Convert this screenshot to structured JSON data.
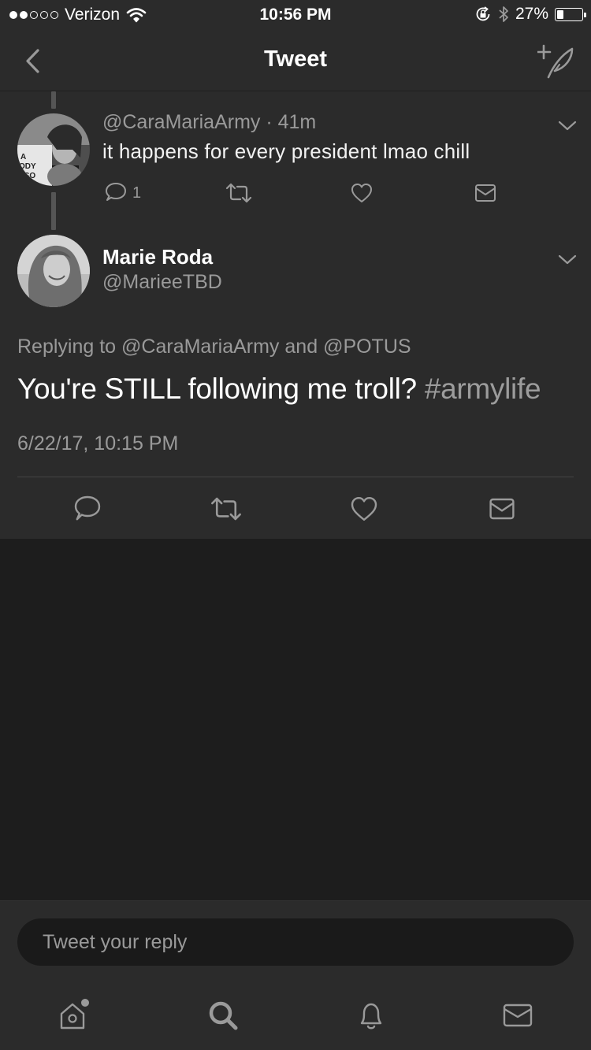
{
  "status_bar": {
    "carrier": "Verizon",
    "time": "10:56 PM",
    "battery": "27%",
    "battery_level": 0.27,
    "signal_bars_filled": 2,
    "signal_bars_total": 5,
    "icons": [
      "wifi-icon",
      "orientation-lock-icon",
      "bluetooth-icon",
      "battery-icon"
    ]
  },
  "nav": {
    "title": "Tweet",
    "back_icon": "chevron-left-icon",
    "compose_icon": "compose-tweet-icon"
  },
  "parent_tweet": {
    "handle": "@CaraMariaArmy",
    "time": "41m",
    "text": "it happens for every president lmao chill",
    "reply_count": "1",
    "menu_icon": "chevron-down-icon"
  },
  "main_tweet": {
    "name": "Marie Roda",
    "handle": "@MarieeTBD",
    "replying_prefix": "Replying to",
    "replying_user_1": "@CaraMariaArmy",
    "replying_and": "and",
    "replying_user_2": "@POTUS",
    "text": "You're STILL following me troll?",
    "hashtag": "#armylife",
    "timestamp": "6/22/17, 10:15 PM",
    "menu_icon": "chevron-down-icon"
  },
  "reply_box": {
    "placeholder": "Tweet your reply"
  },
  "tab_bar": {
    "items": [
      "home-icon",
      "search-icon",
      "notifications-icon",
      "messages-icon"
    ]
  },
  "colors": {
    "background": "#1d1d1d",
    "surface": "#2b2b2b",
    "text": "#ffffff",
    "secondary_text": "#9a9a9a",
    "thread_line": "#555555"
  }
}
